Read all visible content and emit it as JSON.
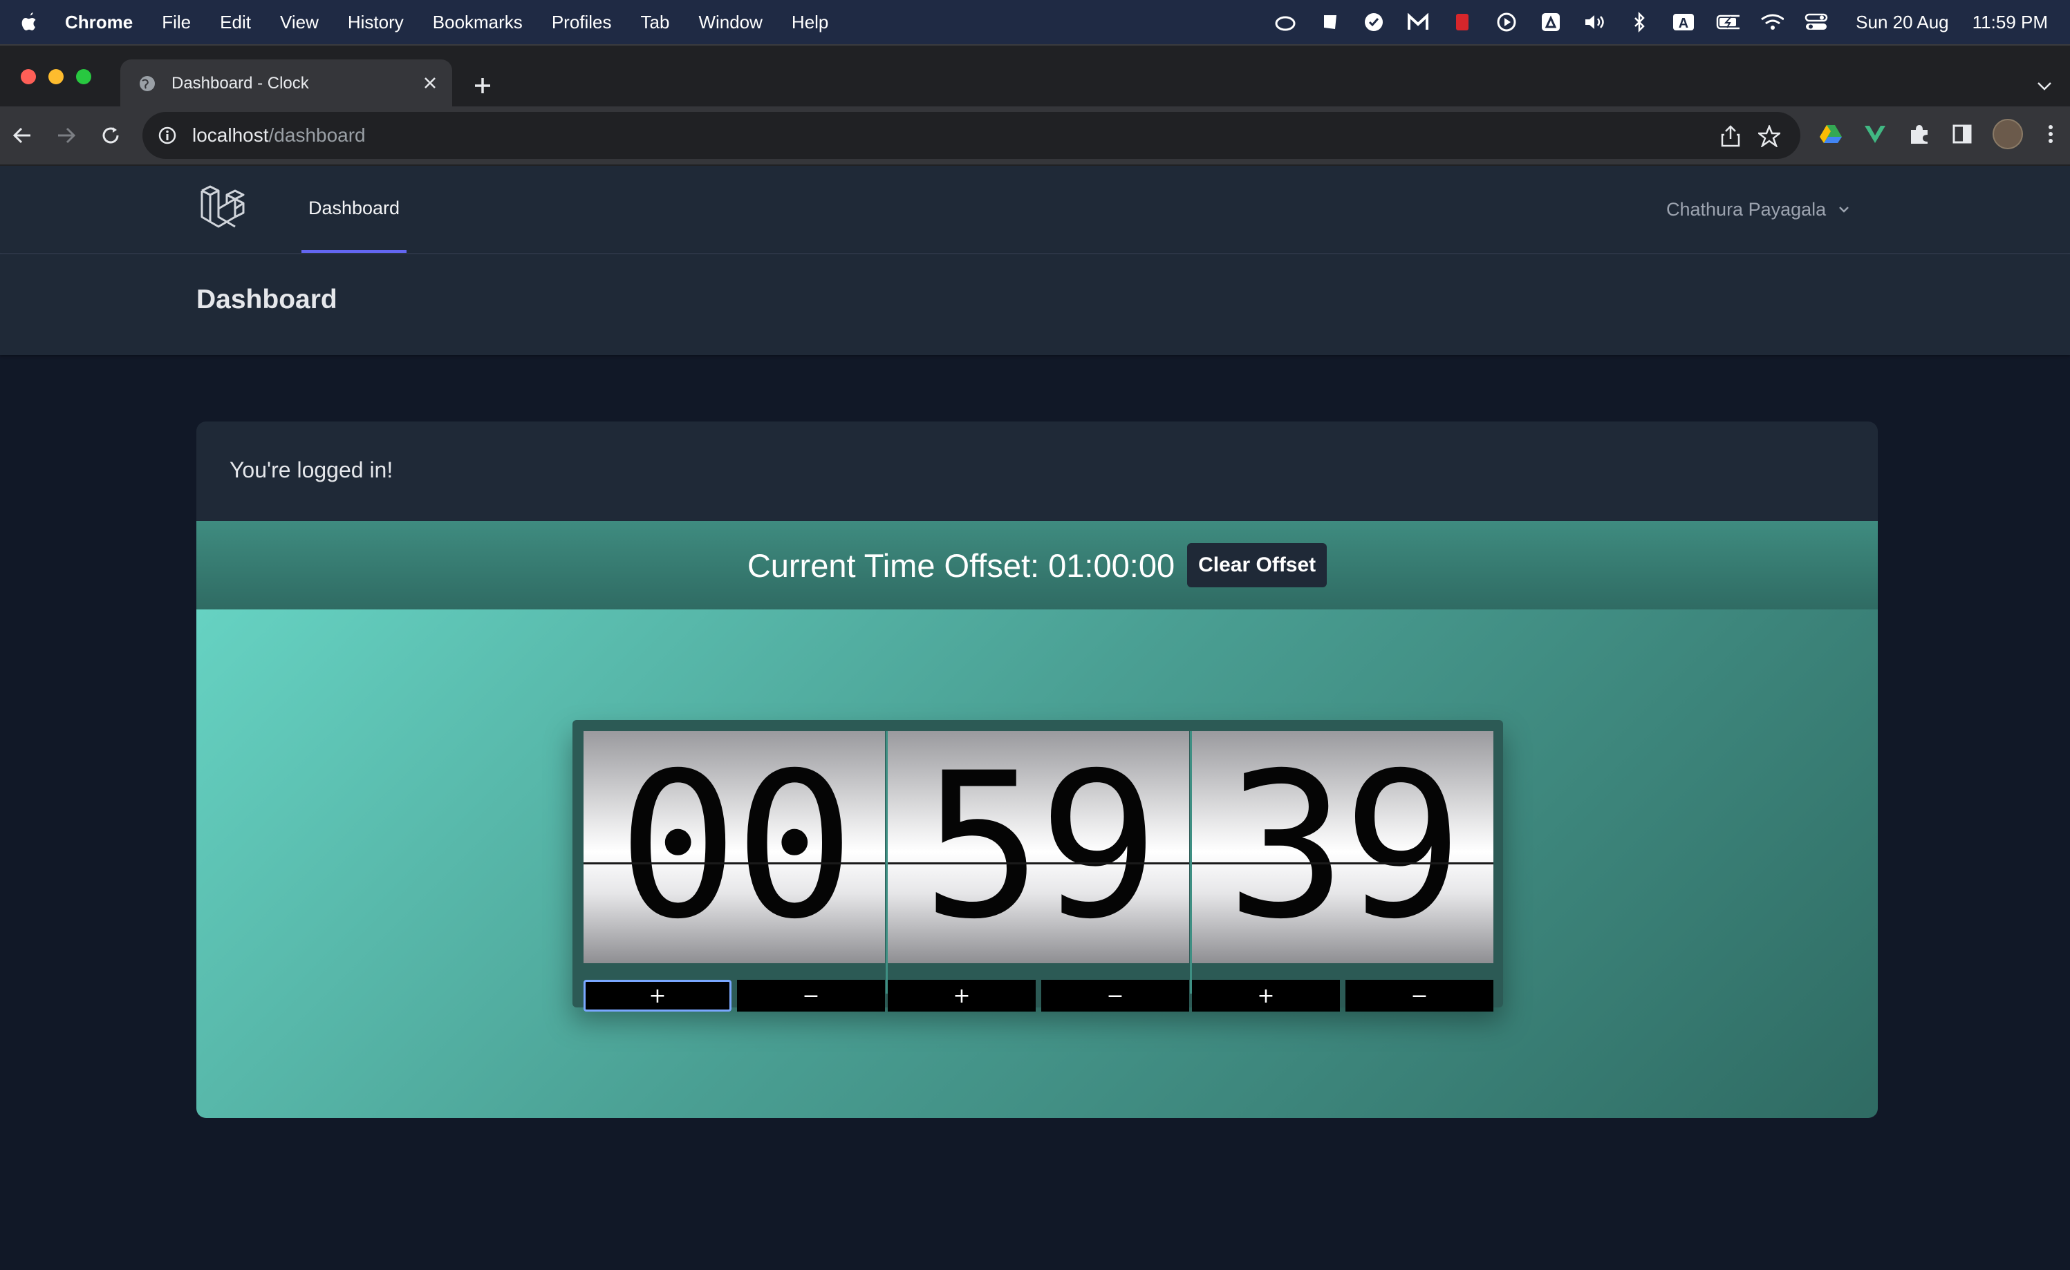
{
  "menubar": {
    "app": "Chrome",
    "items": [
      "File",
      "Edit",
      "View",
      "History",
      "Bookmarks",
      "Profiles",
      "Tab",
      "Window",
      "Help"
    ],
    "date": "Sun 20 Aug",
    "time": "11:59 PM",
    "status_icons": [
      "creative-cloud-icon",
      "sketch-icon",
      "todo-check-icon",
      "gmail-m-icon",
      "red-app-icon",
      "play-icon",
      "drive-icon",
      "volume-icon",
      "bluetooth-icon",
      "keyboard-input-a-icon",
      "battery-charging-icon",
      "wifi-icon",
      "control-center-icon"
    ],
    "input_source_label": "A"
  },
  "browser": {
    "tab_title": "Dashboard - Clock",
    "url_host": "localhost",
    "url_path": "/dashboard"
  },
  "app": {
    "nav_link": "Dashboard",
    "user_name": "Chathura Payagala",
    "page_title": "Dashboard",
    "logged_in_message": "You're logged in!",
    "offset_label": "Current Time Offset: 01:00:00",
    "clear_offset_label": "Clear Offset",
    "clock": {
      "hours": "00",
      "minutes": "59",
      "seconds": "39"
    },
    "steppers": {
      "plus": "+",
      "minus": "−"
    }
  },
  "colors": {
    "page_bg": "#111827",
    "panel_bg": "#1f2937",
    "nav_active": "#6366f1",
    "teal_light": "#66d2c2",
    "teal_dark": "#2f6b63"
  }
}
